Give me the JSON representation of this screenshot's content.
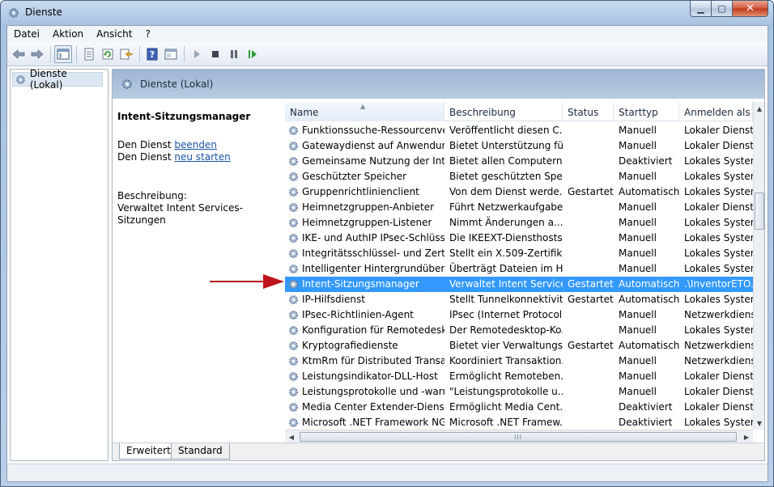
{
  "window": {
    "title": "Dienste",
    "close_glyph": "✕",
    "min_glyph": "▁",
    "max_glyph": "▢"
  },
  "menu": [
    "Datei",
    "Aktion",
    "Ansicht",
    "?"
  ],
  "tree": {
    "root_label": "Dienste (Lokal)"
  },
  "header": {
    "title": "Dienste (Lokal)"
  },
  "detail": {
    "service_name": "Intent-Sitzungsmanager",
    "stop_prefix": "Den Dienst ",
    "stop_link": "beenden",
    "restart_prefix": "Den Dienst ",
    "restart_link": "neu starten",
    "desc_label": "Beschreibung:",
    "desc_text": "Verwaltet Intent Services-Sitzungen"
  },
  "columns": [
    "Name",
    "Beschreibung",
    "Status",
    "Starttyp",
    "Anmelden als"
  ],
  "rows": [
    [
      "Funktionssuche-Ressourcenver...",
      "Veröffentlicht diesen C...",
      "",
      "Manuell",
      "Lokaler Dienst"
    ],
    [
      "Gatewaydienst auf Anwendun...",
      "Bietet Unterstützung fü...",
      "",
      "Manuell",
      "Lokaler Dienst"
    ],
    [
      "Gemeinsame Nutzung der Inte...",
      "Bietet allen Computern ...",
      "",
      "Deaktiviert",
      "Lokales System"
    ],
    [
      "Geschützter Speicher",
      "Bietet geschützten Spei...",
      "",
      "Manuell",
      "Lokales System"
    ],
    [
      "Gruppenrichtlinienclient",
      "Von dem Dienst werde...",
      "Gestartet",
      "Automatisch",
      "Lokales System"
    ],
    [
      "Heimnetzgruppen-Anbieter",
      "Führt Netzwerkaufgabe...",
      "",
      "Manuell",
      "Lokaler Dienst"
    ],
    [
      "Heimnetzgruppen-Listener",
      "Nimmt Änderungen a...",
      "",
      "Manuell",
      "Lokales System"
    ],
    [
      "IKE- und AuthIP IPsec-Schlüsse...",
      "Die IKEEXT-Diensthosts ...",
      "",
      "Manuell",
      "Lokales System"
    ],
    [
      "Integritätsschlüssel- und Zertifi...",
      "Stellt ein X.509-Zertifika...",
      "",
      "Manuell",
      "Lokales System"
    ],
    [
      "Intelligenter Hintergrundübertr...",
      "Überträgt Dateien im Hi...",
      "",
      "Manuell",
      "Lokales System"
    ],
    [
      "Intent-Sitzungsmanager",
      "Verwaltet Intent Service...",
      "Gestartet",
      "Automatisch",
      ".\\InventorETO..."
    ],
    [
      "IP-Hilfsdienst",
      "Stellt Tunnelkonnektivit...",
      "Gestartet",
      "Automatisch",
      "Lokales System"
    ],
    [
      "IPsec-Richtlinien-Agent",
      "IPsec (Internet Protocol...",
      "",
      "Manuell",
      "Netzwerkdienst"
    ],
    [
      "Konfiguration für Remotedeskt...",
      "Der Remotedesktop-Ko...",
      "",
      "Manuell",
      "Lokales System"
    ],
    [
      "Kryptografiedienste",
      "Bietet vier Verwaltungs...",
      "Gestartet",
      "Automatisch",
      "Netzwerkdienst"
    ],
    [
      "KtmRm für Distributed Transac...",
      "Koordiniert Transaktion...",
      "",
      "Manuell",
      "Netzwerkdienst"
    ],
    [
      "Leistungsindikator-DLL-Host",
      "Ermöglicht Remoteben...",
      "",
      "Manuell",
      "Lokaler Dienst"
    ],
    [
      "Leistungsprotokolle und -warn...",
      "\"Leistungsprotokolle u...",
      "",
      "Manuell",
      "Lokaler Dienst"
    ],
    [
      "Media Center Extender-Dienst",
      "Ermöglicht Media Cent...",
      "",
      "Deaktiviert",
      "Lokaler Dienst"
    ],
    [
      "Microsoft .NET Framework NG...",
      "Microsoft .NET Framew...",
      "",
      "Deaktiviert",
      "Lokales System"
    ]
  ],
  "selected_row": 10,
  "tabs": [
    "Erweitert",
    "Standard"
  ],
  "scroll": {
    "hscroll_grip": "III",
    "up": "▲",
    "down": "▼",
    "left": "◀",
    "right": "▶",
    "sort": "▲"
  },
  "colors": {
    "selection": "#3399ff",
    "arrow": "#c0141c",
    "link": "#1a53a8"
  }
}
